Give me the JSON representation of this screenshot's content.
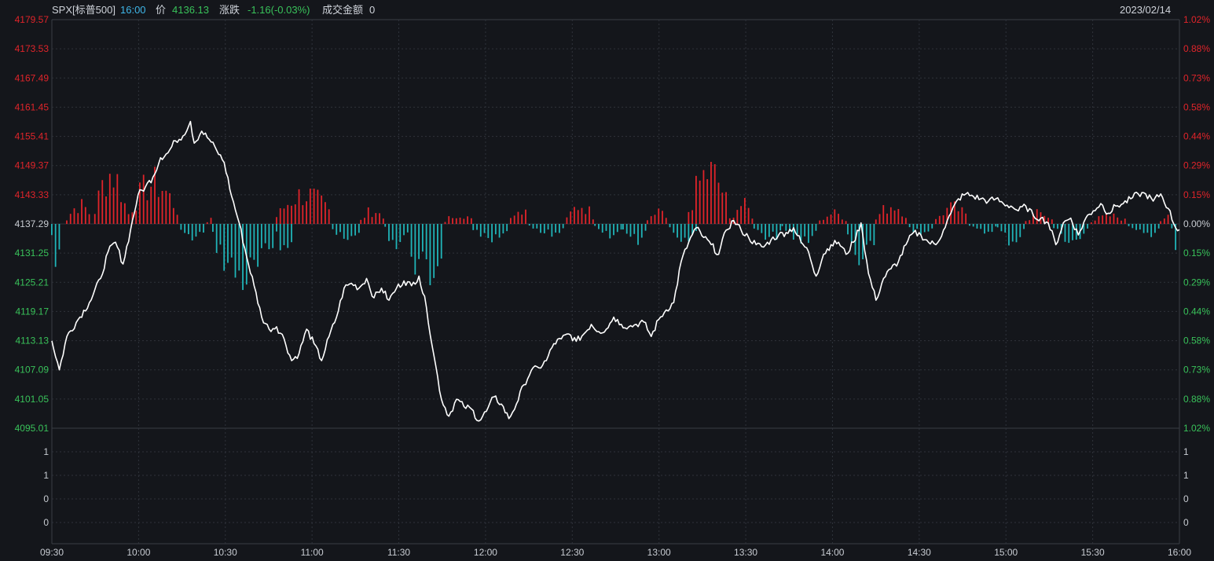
{
  "header": {
    "symbol": "SPX[标普500]",
    "time": "16:00",
    "price_label": "价",
    "price": "4136.13",
    "change_label": "涨跌",
    "change": "-1.16(-0.03%)",
    "turnover_label": "成交金额",
    "turnover": "0",
    "date": "2023/02/14"
  },
  "colors": {
    "background": "#14161b",
    "up": "#e0242a",
    "down": "#20b4b8",
    "price_line": "#ffffff",
    "grid": "#2f333b",
    "axis_up_text": "#e0242a",
    "axis_down_text": "#39c25a",
    "axis_neutral_text": "#c8ccd2"
  },
  "chart_data": {
    "type": "line",
    "base_price": 4137.29,
    "x_ticks": [
      "09:30",
      "10:00",
      "10:30",
      "11:00",
      "11:30",
      "12:00",
      "12:30",
      "13:00",
      "13:30",
      "14:00",
      "14:30",
      "15:00",
      "15:30",
      "16:00"
    ],
    "price_axis_left": [
      "4179.57",
      "4173.53",
      "4167.49",
      "4161.45",
      "4155.41",
      "4149.37",
      "4143.33",
      "4137.29",
      "4131.25",
      "4125.21",
      "4119.17",
      "4113.13",
      "4107.09",
      "4101.05",
      "4095.01"
    ],
    "percent_axis_right": [
      "1.02%",
      "0.88%",
      "0.73%",
      "0.58%",
      "0.44%",
      "0.29%",
      "0.15%",
      "0.00%",
      "0.15%",
      "0.29%",
      "0.44%",
      "0.58%",
      "0.73%",
      "0.88%",
      "1.02%"
    ],
    "ylim": [
      4095.01,
      4179.57
    ],
    "volume_axis": [
      "1",
      "1",
      "0",
      "0"
    ],
    "price_keypoints": [
      [
        0,
        4113.1
      ],
      [
        4,
        4107.1
      ],
      [
        8,
        4114.0
      ],
      [
        14,
        4117.5
      ],
      [
        20,
        4121.0
      ],
      [
        26,
        4126.0
      ],
      [
        30,
        4131.5
      ],
      [
        34,
        4133.5
      ],
      [
        38,
        4129.0
      ],
      [
        42,
        4136.0
      ],
      [
        46,
        4143.3
      ],
      [
        50,
        4145.0
      ],
      [
        54,
        4147.0
      ],
      [
        58,
        4151.0
      ],
      [
        62,
        4152.0
      ],
      [
        66,
        4154.5
      ],
      [
        70,
        4155.5
      ],
      [
        74,
        4158.5
      ],
      [
        76,
        4154.0
      ],
      [
        80,
        4156.5
      ],
      [
        84,
        4154.8
      ],
      [
        88,
        4152.5
      ],
      [
        92,
        4150.0
      ],
      [
        96,
        4143.0
      ],
      [
        100,
        4137.5
      ],
      [
        104,
        4130.5
      ],
      [
        108,
        4124.5
      ],
      [
        112,
        4118.0
      ],
      [
        116,
        4115.5
      ],
      [
        120,
        4116.0
      ],
      [
        124,
        4113.5
      ],
      [
        128,
        4109.0
      ],
      [
        132,
        4110.5
      ],
      [
        136,
        4115.5
      ],
      [
        140,
        4112.5
      ],
      [
        144,
        4109.0
      ],
      [
        148,
        4114.0
      ],
      [
        152,
        4118.0
      ],
      [
        156,
        4124.0
      ],
      [
        160,
        4125.0
      ],
      [
        164,
        4124.0
      ],
      [
        168,
        4126.0
      ],
      [
        172,
        4122.0
      ],
      [
        176,
        4124.0
      ],
      [
        180,
        4121.5
      ],
      [
        184,
        4124.0
      ],
      [
        188,
        4125.5
      ],
      [
        192,
        4124.5
      ],
      [
        196,
        4126.5
      ],
      [
        200,
        4120.0
      ],
      [
        204,
        4110.0
      ],
      [
        208,
        4101.0
      ],
      [
        212,
        4097.5
      ],
      [
        216,
        4101.0
      ],
      [
        220,
        4099.5
      ],
      [
        224,
        4099.0
      ],
      [
        228,
        4096.5
      ],
      [
        232,
        4098.5
      ],
      [
        236,
        4101.5
      ],
      [
        240,
        4100.0
      ],
      [
        244,
        4097.0
      ],
      [
        248,
        4100.0
      ],
      [
        252,
        4104.0
      ],
      [
        256,
        4107.0
      ],
      [
        260,
        4107.5
      ],
      [
        264,
        4109.0
      ],
      [
        268,
        4112.5
      ],
      [
        272,
        4113.5
      ],
      [
        276,
        4114.5
      ],
      [
        280,
        4113.0
      ],
      [
        284,
        4114.5
      ],
      [
        288,
        4116.5
      ],
      [
        292,
        4115.0
      ],
      [
        296,
        4115.5
      ],
      [
        300,
        4118.0
      ],
      [
        304,
        4116.5
      ],
      [
        308,
        4116.0
      ],
      [
        312,
        4116.5
      ],
      [
        316,
        4117.0
      ],
      [
        320,
        4114.0
      ],
      [
        324,
        4117.5
      ],
      [
        328,
        4119.5
      ],
      [
        332,
        4121.0
      ],
      [
        336,
        4129.5
      ],
      [
        340,
        4133.5
      ],
      [
        344,
        4136.5
      ],
      [
        348,
        4134.5
      ],
      [
        352,
        4133.0
      ],
      [
        356,
        4131.0
      ],
      [
        360,
        4136.0
      ],
      [
        364,
        4138.0
      ],
      [
        368,
        4136.0
      ],
      [
        372,
        4134.5
      ],
      [
        376,
        4133.0
      ],
      [
        380,
        4132.5
      ],
      [
        384,
        4134.0
      ],
      [
        388,
        4135.0
      ],
      [
        392,
        4135.5
      ],
      [
        396,
        4136.5
      ],
      [
        400,
        4133.5
      ],
      [
        404,
        4131.5
      ],
      [
        408,
        4126.5
      ],
      [
        412,
        4131.0
      ],
      [
        416,
        4133.0
      ],
      [
        420,
        4133.5
      ],
      [
        424,
        4131.0
      ],
      [
        428,
        4133.5
      ],
      [
        432,
        4137.5
      ],
      [
        436,
        4127.0
      ],
      [
        440,
        4121.5
      ],
      [
        444,
        4126.0
      ],
      [
        448,
        4128.0
      ],
      [
        452,
        4129.5
      ],
      [
        456,
        4133.0
      ],
      [
        460,
        4135.5
      ],
      [
        464,
        4135.0
      ],
      [
        468,
        4133.5
      ],
      [
        472,
        4133.0
      ],
      [
        476,
        4136.0
      ],
      [
        480,
        4139.5
      ],
      [
        484,
        4142.5
      ],
      [
        488,
        4143.5
      ],
      [
        492,
        4143.0
      ],
      [
        496,
        4142.5
      ],
      [
        500,
        4142.0
      ],
      [
        504,
        4142.5
      ],
      [
        508,
        4141.5
      ],
      [
        512,
        4141.0
      ],
      [
        516,
        4140.0
      ],
      [
        520,
        4141.0
      ],
      [
        524,
        4139.0
      ],
      [
        528,
        4138.5
      ],
      [
        532,
        4137.5
      ],
      [
        536,
        4133.0
      ],
      [
        540,
        4137.5
      ],
      [
        544,
        4138.5
      ],
      [
        548,
        4135.0
      ],
      [
        552,
        4138.5
      ],
      [
        556,
        4140.0
      ],
      [
        560,
        4141.5
      ],
      [
        564,
        4139.5
      ],
      [
        568,
        4141.0
      ],
      [
        572,
        4141.5
      ],
      [
        576,
        4142.5
      ],
      [
        580,
        4143.5
      ],
      [
        584,
        4143.5
      ],
      [
        588,
        4142.0
      ],
      [
        592,
        4143.5
      ],
      [
        596,
        4140.5
      ],
      [
        600,
        4136.5
      ],
      [
        602,
        4136.1
      ]
    ],
    "volume_bars": [
      {
        "start": 0,
        "end": 6,
        "sign": -1,
        "peak": 0.85
      },
      {
        "start": 8,
        "end": 22,
        "sign": 1,
        "peak": 0.35
      },
      {
        "start": 23,
        "end": 40,
        "sign": 1,
        "peak": 0.95
      },
      {
        "start": 41,
        "end": 68,
        "sign": 1,
        "peak": 0.75
      },
      {
        "start": 69,
        "end": 82,
        "sign": -1,
        "peak": 0.3
      },
      {
        "start": 83,
        "end": 86,
        "sign": 1,
        "peak": 0.15
      },
      {
        "start": 86,
        "end": 120,
        "sign": -1,
        "peak": 1.0
      },
      {
        "start": 120,
        "end": 130,
        "sign": -1,
        "peak": 0.5
      },
      {
        "start": 120,
        "end": 150,
        "sign": 1,
        "peak": 0.55
      },
      {
        "start": 150,
        "end": 165,
        "sign": -1,
        "peak": 0.35
      },
      {
        "start": 165,
        "end": 178,
        "sign": 1,
        "peak": 0.25
      },
      {
        "start": 178,
        "end": 190,
        "sign": -1,
        "peak": 0.35
      },
      {
        "start": 190,
        "end": 210,
        "sign": -1,
        "peak": 1.0
      },
      {
        "start": 210,
        "end": 225,
        "sign": 1,
        "peak": 0.2
      },
      {
        "start": 225,
        "end": 245,
        "sign": -1,
        "peak": 0.35
      },
      {
        "start": 245,
        "end": 255,
        "sign": 1,
        "peak": 0.35
      },
      {
        "start": 255,
        "end": 275,
        "sign": -1,
        "peak": 0.2
      },
      {
        "start": 275,
        "end": 290,
        "sign": 1,
        "peak": 0.35
      },
      {
        "start": 290,
        "end": 305,
        "sign": -1,
        "peak": 0.25
      },
      {
        "start": 305,
        "end": 318,
        "sign": -1,
        "peak": 0.3
      },
      {
        "start": 318,
        "end": 330,
        "sign": 1,
        "peak": 0.2
      },
      {
        "start": 330,
        "end": 345,
        "sign": -1,
        "peak": 0.25
      },
      {
        "start": 340,
        "end": 362,
        "sign": 1,
        "peak": 0.95
      },
      {
        "start": 362,
        "end": 375,
        "sign": 1,
        "peak": 0.35
      },
      {
        "start": 375,
        "end": 390,
        "sign": -1,
        "peak": 0.3
      },
      {
        "start": 390,
        "end": 410,
        "sign": -1,
        "peak": 0.3
      },
      {
        "start": 410,
        "end": 425,
        "sign": 1,
        "peak": 0.2
      },
      {
        "start": 425,
        "end": 440,
        "sign": -1,
        "peak": 0.8
      },
      {
        "start": 440,
        "end": 458,
        "sign": 1,
        "peak": 0.35
      },
      {
        "start": 458,
        "end": 472,
        "sign": -1,
        "peak": 0.2
      },
      {
        "start": 472,
        "end": 490,
        "sign": 1,
        "peak": 0.3
      },
      {
        "start": 490,
        "end": 505,
        "sign": -1,
        "peak": 0.15
      },
      {
        "start": 505,
        "end": 520,
        "sign": -1,
        "peak": 0.3
      },
      {
        "start": 520,
        "end": 535,
        "sign": 1,
        "peak": 0.2
      },
      {
        "start": 535,
        "end": 555,
        "sign": -1,
        "peak": 0.3
      },
      {
        "start": 555,
        "end": 575,
        "sign": 1,
        "peak": 0.15
      },
      {
        "start": 575,
        "end": 592,
        "sign": -1,
        "peak": 0.2
      },
      {
        "start": 592,
        "end": 598,
        "sign": 1,
        "peak": 0.2
      },
      {
        "start": 598,
        "end": 602,
        "sign": -1,
        "peak": 0.5
      }
    ]
  }
}
